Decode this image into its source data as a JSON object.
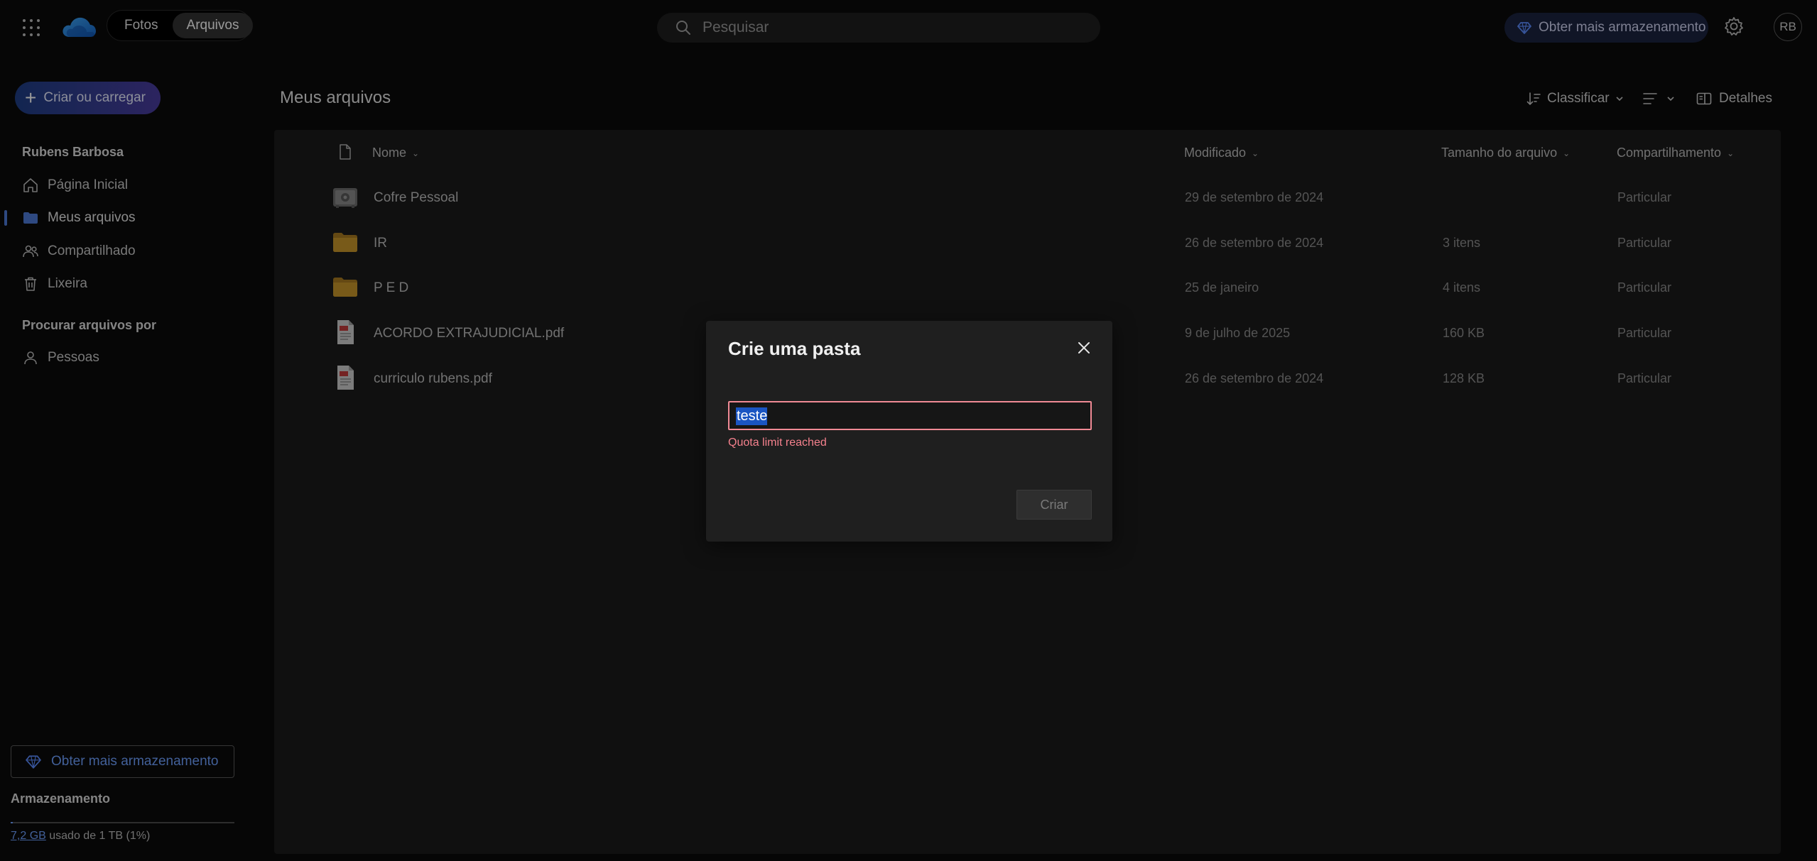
{
  "header": {
    "tabs": [
      {
        "label": "Fotos",
        "active": false
      },
      {
        "label": "Arquivos",
        "active": true
      }
    ],
    "search_placeholder": "Pesquisar",
    "premium_label": "Obter mais armazenamento",
    "avatar_initials": "RB"
  },
  "sidebar": {
    "create_label": "Criar ou carregar",
    "user_name": "Rubens Barbosa",
    "nav": [
      {
        "label": "Página Inicial",
        "icon": "home-icon",
        "active": false
      },
      {
        "label": "Meus arquivos",
        "icon": "folder-icon",
        "active": true
      },
      {
        "label": "Compartilhado",
        "icon": "people-icon",
        "active": false
      },
      {
        "label": "Lixeira",
        "icon": "trash-icon",
        "active": false
      }
    ],
    "browse_heading": "Procurar arquivos por",
    "browse_items": [
      {
        "label": "Pessoas",
        "icon": "person-icon"
      }
    ],
    "premium_label": "Obter mais armazenamento",
    "storage": {
      "title": "Armazenamento",
      "used": "7,2 GB",
      "rest": " usado de 1 TB (1%)",
      "percent": 1
    }
  },
  "main": {
    "title": "Meus arquivos",
    "toolbar": {
      "sort_label": "Classificar",
      "details_label": "Detalhes"
    },
    "columns": {
      "name": "Nome",
      "modified": "Modificado",
      "size": "Tamanho do arquivo",
      "sharing": "Compartilhamento"
    },
    "rows": [
      {
        "icon": "vault-icon",
        "name": "Cofre Pessoal",
        "modified": "29 de setembro de 2024",
        "size": "",
        "sharing": "Particular"
      },
      {
        "icon": "folder-icon",
        "name": "IR",
        "modified": "26 de setembro de 2024",
        "size": "3 itens",
        "sharing": "Particular"
      },
      {
        "icon": "folder-icon",
        "name": "P E D",
        "modified": "25 de janeiro",
        "size": "4 itens",
        "sharing": "Particular"
      },
      {
        "icon": "pdf-icon",
        "name": "ACORDO EXTRAJUDICIAL.pdf",
        "modified": "9 de julho de 2025",
        "size": "160 KB",
        "sharing": "Particular"
      },
      {
        "icon": "pdf-icon",
        "name": "curriculo rubens.pdf",
        "modified": "26 de setembro de 2024",
        "size": "128 KB",
        "sharing": "Particular"
      }
    ]
  },
  "dialog": {
    "title": "Crie uma pasta",
    "input_value": "teste",
    "error": "Quota limit reached",
    "create_label": "Criar"
  },
  "colors": {
    "accent": "#6ea0ff",
    "error": "#f5818d",
    "folder": "#c9962a"
  }
}
